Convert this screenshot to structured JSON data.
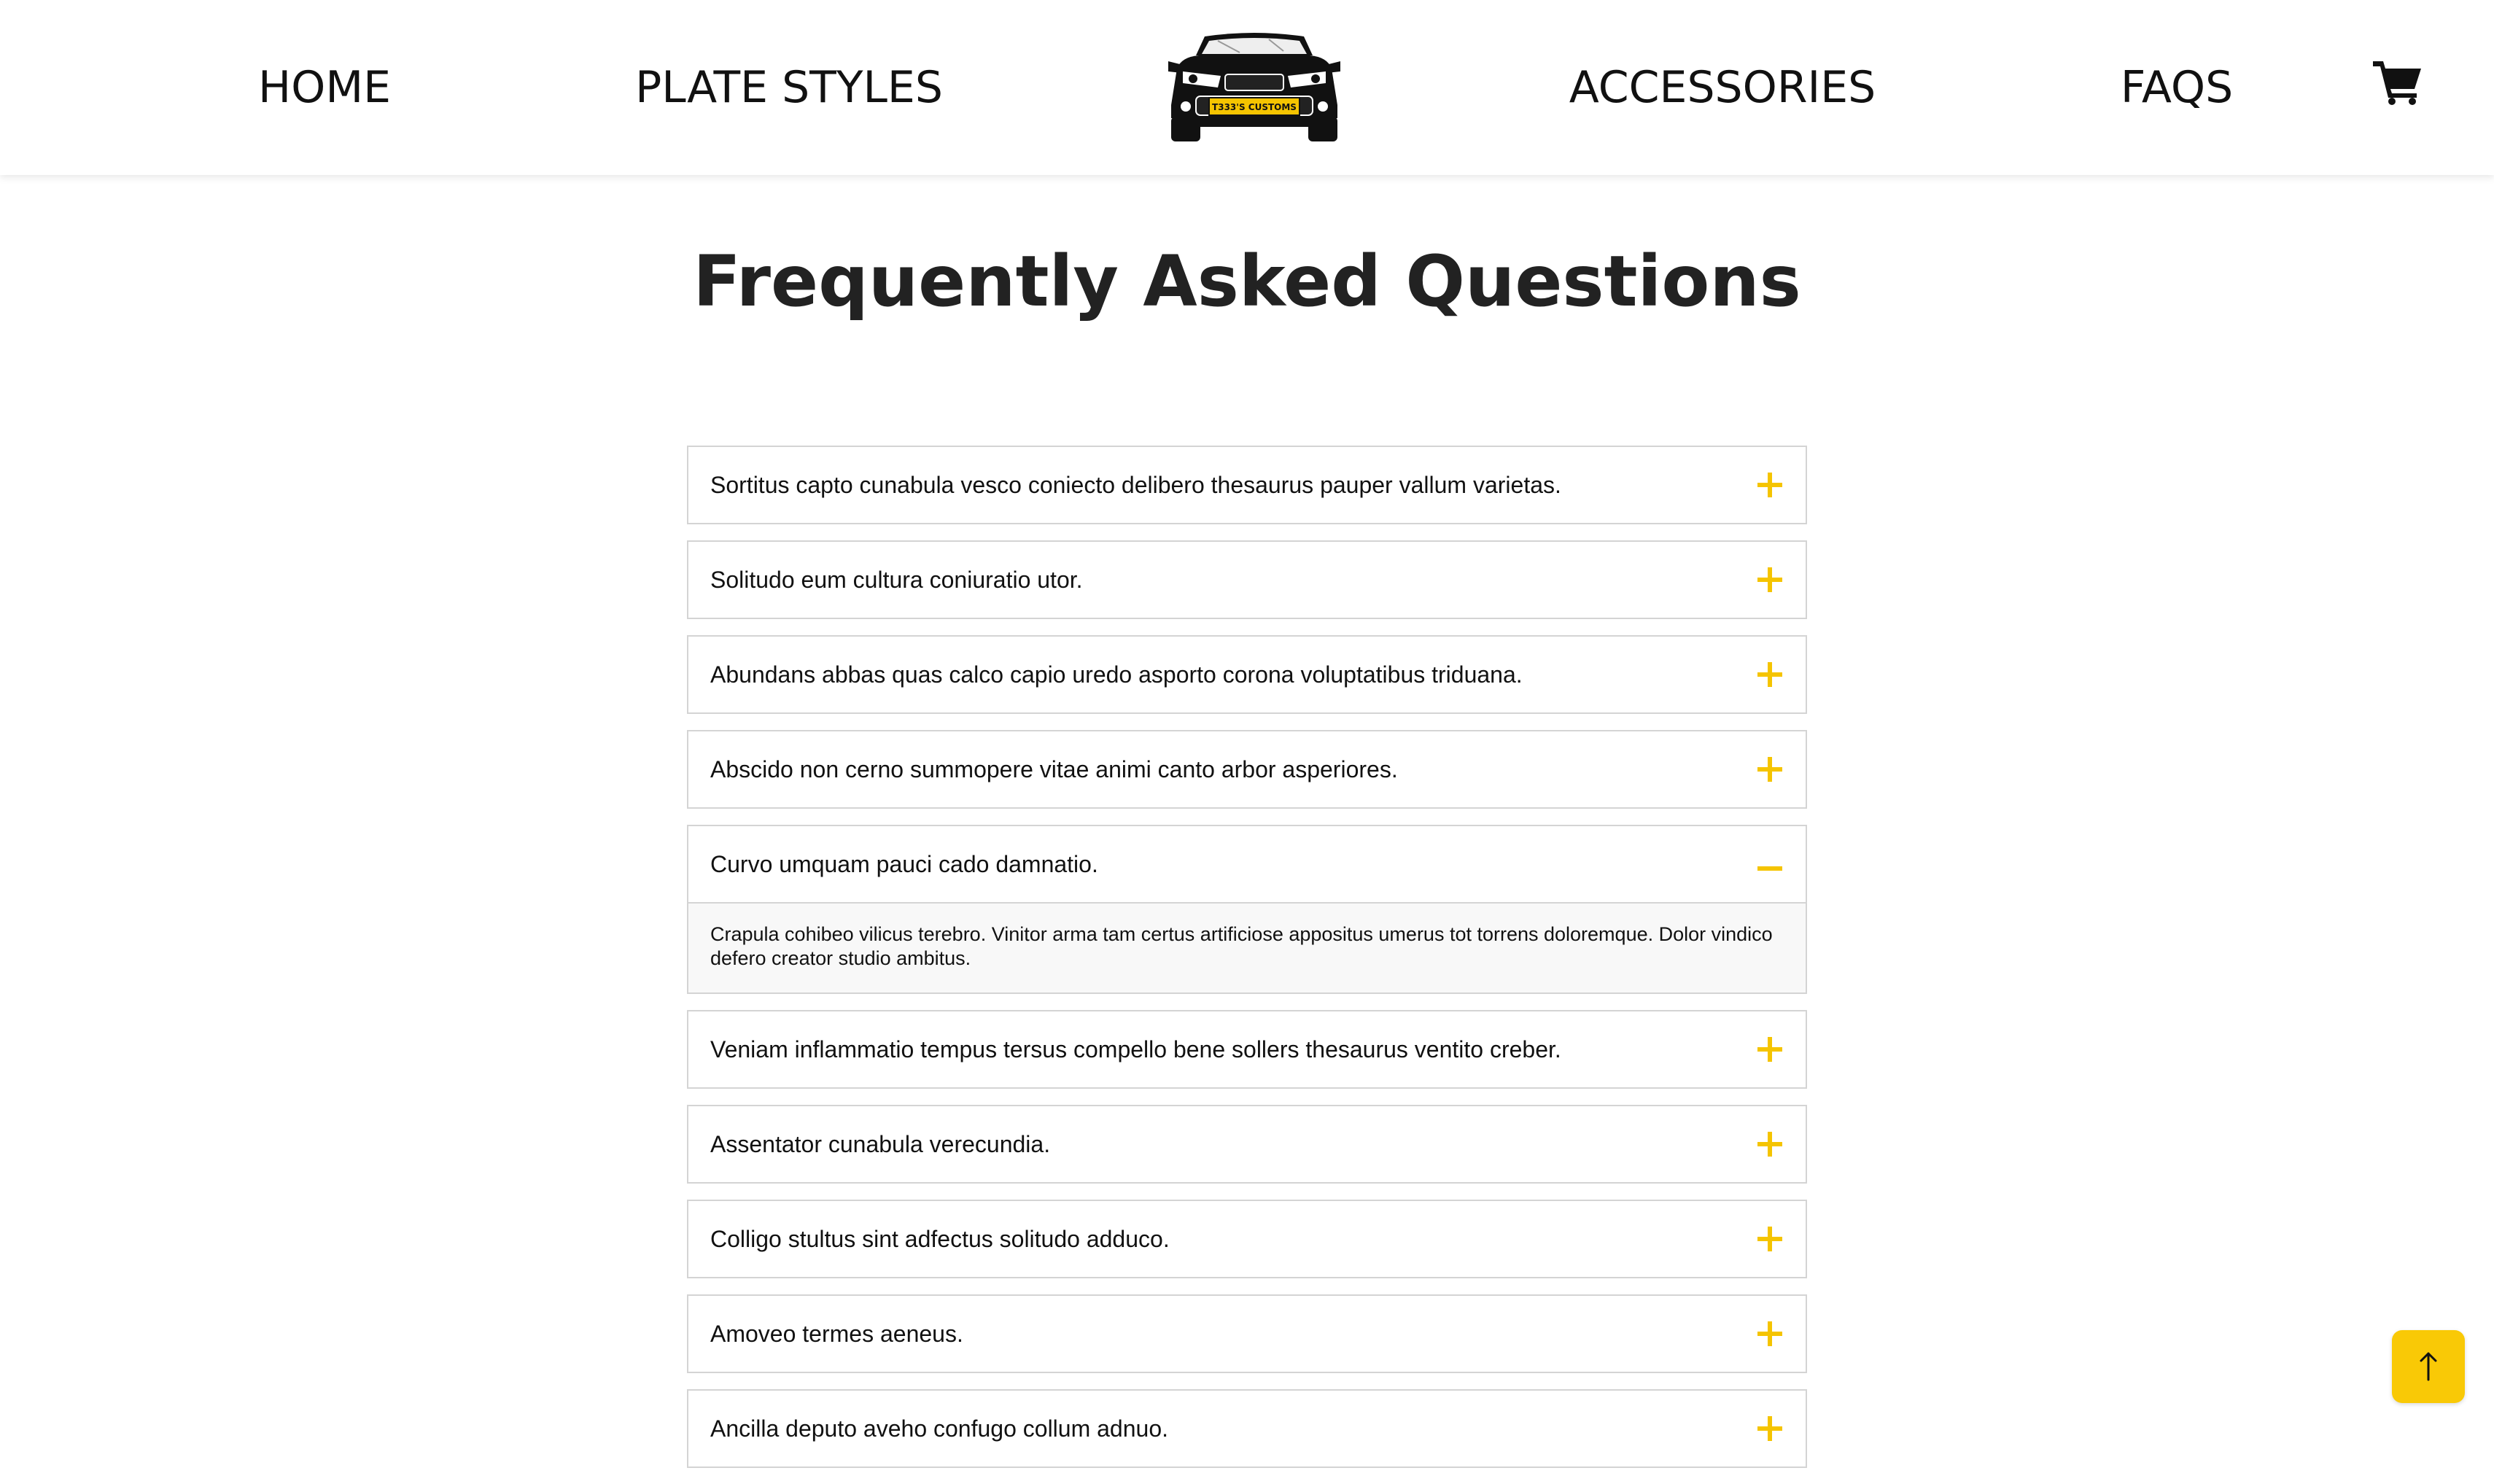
{
  "nav": {
    "home": "HOME",
    "plate_styles": "PLATE STYLES",
    "accessories": "ACCESSORIES",
    "faqs": "FAQS",
    "logo_plate_text": "T333'S CUSTOMS",
    "cart_icon": "shopping-cart-icon"
  },
  "page_title": "Frequently Asked Questions",
  "faqs": [
    {
      "question": "Sortitus capto cunabula vesco coniecto delibero thesaurus pauper vallum varietas.",
      "expanded": false
    },
    {
      "question": "Solitudo eum cultura coniuratio utor.",
      "expanded": false
    },
    {
      "question": "Abundans abbas quas calco capio uredo asporto corona voluptatibus triduana.",
      "expanded": false
    },
    {
      "question": "Abscido non cerno summopere vitae animi canto arbor asperiores.",
      "expanded": false
    },
    {
      "question": "Curvo umquam pauci cado damnatio.",
      "expanded": true,
      "answer": "Crapula cohibeo vilicus terebro. Vinitor arma tam certus artificiose appositus umerus tot torrens doloremque. Dolor vindico defero creator studio ambitus."
    },
    {
      "question": "Veniam inflammatio tempus tersus compello bene sollers thesaurus ventito creber.",
      "expanded": false
    },
    {
      "question": "Assentator cunabula verecundia.",
      "expanded": false
    },
    {
      "question": "Colligo stultus sint adfectus solitudo adduco.",
      "expanded": false
    },
    {
      "question": "Amoveo termes aeneus.",
      "expanded": false
    },
    {
      "question": "Ancilla deputo aveho confugo collum adnuo.",
      "expanded": false
    }
  ],
  "icons": {
    "expand": "plus-icon",
    "collapse": "minus-icon",
    "scroll_top": "arrow-up-icon"
  },
  "colors": {
    "accent": "#f5c400",
    "scroll_top_bg": "#f9c906",
    "border": "#d4d4d4",
    "answer_bg": "#f8f8f8"
  }
}
